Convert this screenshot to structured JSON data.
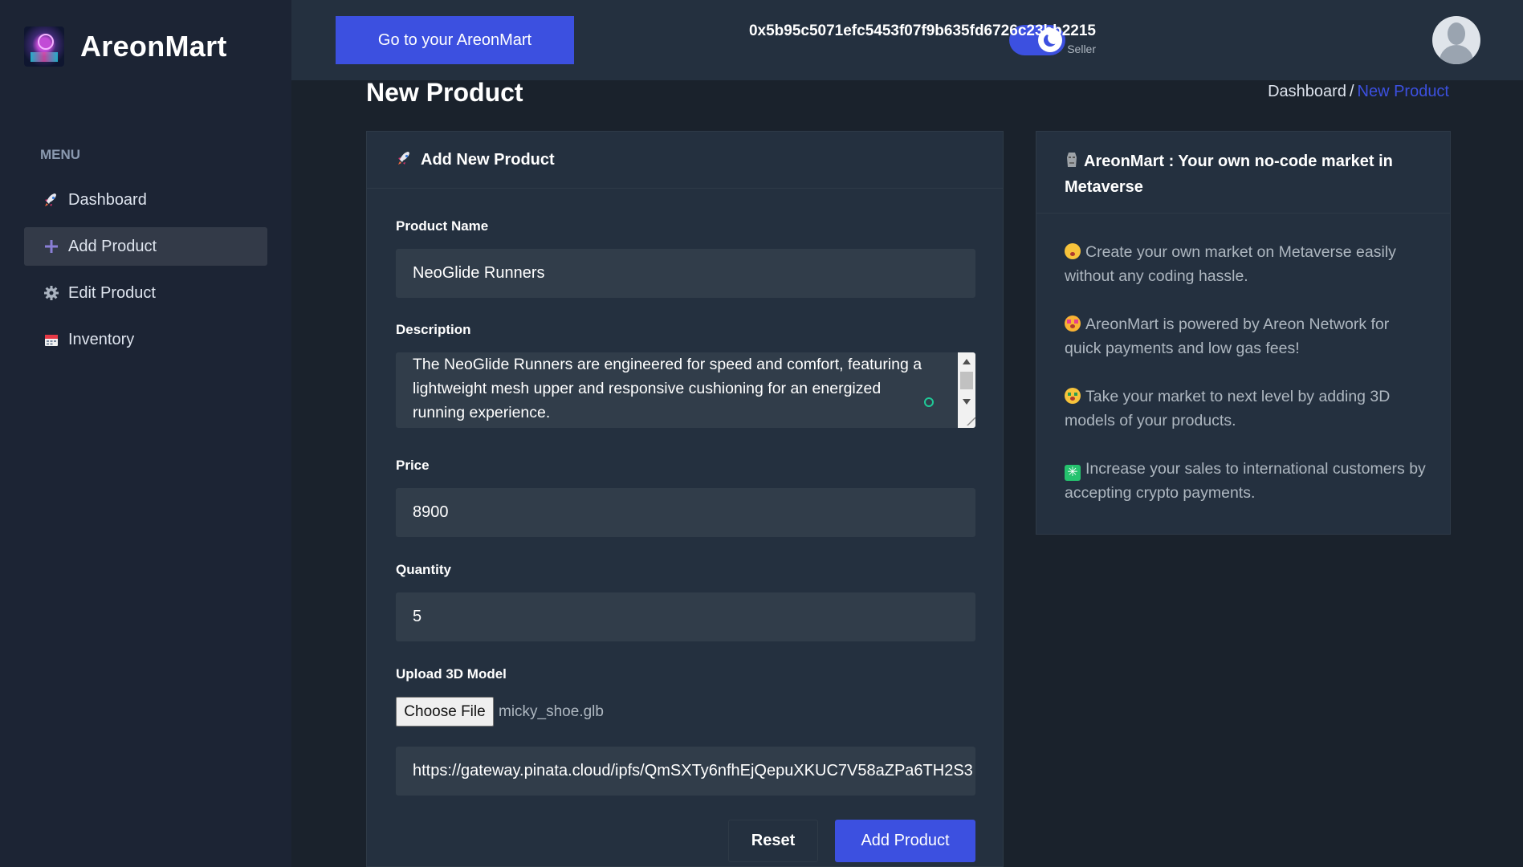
{
  "app": {
    "name": "AreonMart"
  },
  "sidebar": {
    "menu_heading": "MENU",
    "items": [
      {
        "label": "Dashboard",
        "icon": "rocket-icon"
      },
      {
        "label": "Add Product",
        "icon": "plus-icon"
      },
      {
        "label": "Edit Product",
        "icon": "gear-icon"
      },
      {
        "label": "Inventory",
        "icon": "calendar-icon"
      }
    ]
  },
  "header": {
    "goto_label": "Go to your AreonMart",
    "theme_toggle": "dark",
    "wallet_address": "0x5b95c5071efc5453f07f9b635fd6726c23bb2215",
    "wallet_role": "Seller"
  },
  "page": {
    "title": "New Product",
    "breadcrumb": {
      "parent": "Dashboard",
      "separator": "/",
      "current": "New Product"
    }
  },
  "form": {
    "heading": "Add New Product",
    "product_name": {
      "label": "Product Name",
      "value": "NeoGlide Runners"
    },
    "description": {
      "label": "Description",
      "value": "The NeoGlide Runners are engineered for speed and comfort, featuring a lightweight mesh upper and responsive cushioning for an energized running experience."
    },
    "price": {
      "label": "Price",
      "value": "8900"
    },
    "quantity": {
      "label": "Quantity",
      "value": "5"
    },
    "upload": {
      "label": "Upload 3D Model",
      "choose_label": "Choose File",
      "file_name": "micky_shoe.glb",
      "url": "https://gateway.pinata.cloud/ipfs/QmSXTy6nfhEjQepuXKUC7V58aZPa6TH2S3"
    },
    "reset_label": "Reset",
    "submit_label": "Add Product"
  },
  "info": {
    "heading": "AreonMart : Your own no-code market in Metaverse",
    "items": [
      {
        "emoji": "flushed-face-icon",
        "text": "Create your own market on Metaverse easily without any coding hassle."
      },
      {
        "emoji": "star-struck-face-icon",
        "text": "AreonMart is powered by Areon Network for quick payments and low gas fees!"
      },
      {
        "emoji": "money-mouth-face-icon",
        "text": "Take your market to next level by adding 3D models of your products."
      },
      {
        "emoji": "sparkle-icon",
        "text": "Increase your sales to international customers by accepting crypto payments."
      }
    ]
  },
  "colors": {
    "accent": "#3c50e0",
    "sidebar_bg": "#1c2434",
    "header_bg": "#24303f",
    "page_bg": "#1a222c"
  }
}
